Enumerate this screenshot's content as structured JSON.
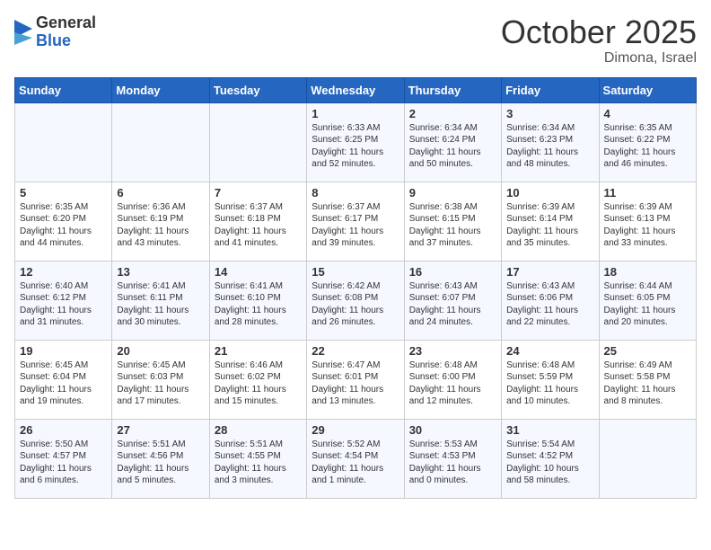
{
  "logo": {
    "general": "General",
    "blue": "Blue"
  },
  "header": {
    "month": "October 2025",
    "location": "Dimona, Israel"
  },
  "weekdays": [
    "Sunday",
    "Monday",
    "Tuesday",
    "Wednesday",
    "Thursday",
    "Friday",
    "Saturday"
  ],
  "weeks": [
    [
      {
        "day": "",
        "content": ""
      },
      {
        "day": "",
        "content": ""
      },
      {
        "day": "",
        "content": ""
      },
      {
        "day": "1",
        "content": "Sunrise: 6:33 AM\nSunset: 6:25 PM\nDaylight: 11 hours\nand 52 minutes."
      },
      {
        "day": "2",
        "content": "Sunrise: 6:34 AM\nSunset: 6:24 PM\nDaylight: 11 hours\nand 50 minutes."
      },
      {
        "day": "3",
        "content": "Sunrise: 6:34 AM\nSunset: 6:23 PM\nDaylight: 11 hours\nand 48 minutes."
      },
      {
        "day": "4",
        "content": "Sunrise: 6:35 AM\nSunset: 6:22 PM\nDaylight: 11 hours\nand 46 minutes."
      }
    ],
    [
      {
        "day": "5",
        "content": "Sunrise: 6:35 AM\nSunset: 6:20 PM\nDaylight: 11 hours\nand 44 minutes."
      },
      {
        "day": "6",
        "content": "Sunrise: 6:36 AM\nSunset: 6:19 PM\nDaylight: 11 hours\nand 43 minutes."
      },
      {
        "day": "7",
        "content": "Sunrise: 6:37 AM\nSunset: 6:18 PM\nDaylight: 11 hours\nand 41 minutes."
      },
      {
        "day": "8",
        "content": "Sunrise: 6:37 AM\nSunset: 6:17 PM\nDaylight: 11 hours\nand 39 minutes."
      },
      {
        "day": "9",
        "content": "Sunrise: 6:38 AM\nSunset: 6:15 PM\nDaylight: 11 hours\nand 37 minutes."
      },
      {
        "day": "10",
        "content": "Sunrise: 6:39 AM\nSunset: 6:14 PM\nDaylight: 11 hours\nand 35 minutes."
      },
      {
        "day": "11",
        "content": "Sunrise: 6:39 AM\nSunset: 6:13 PM\nDaylight: 11 hours\nand 33 minutes."
      }
    ],
    [
      {
        "day": "12",
        "content": "Sunrise: 6:40 AM\nSunset: 6:12 PM\nDaylight: 11 hours\nand 31 minutes."
      },
      {
        "day": "13",
        "content": "Sunrise: 6:41 AM\nSunset: 6:11 PM\nDaylight: 11 hours\nand 30 minutes."
      },
      {
        "day": "14",
        "content": "Sunrise: 6:41 AM\nSunset: 6:10 PM\nDaylight: 11 hours\nand 28 minutes."
      },
      {
        "day": "15",
        "content": "Sunrise: 6:42 AM\nSunset: 6:08 PM\nDaylight: 11 hours\nand 26 minutes."
      },
      {
        "day": "16",
        "content": "Sunrise: 6:43 AM\nSunset: 6:07 PM\nDaylight: 11 hours\nand 24 minutes."
      },
      {
        "day": "17",
        "content": "Sunrise: 6:43 AM\nSunset: 6:06 PM\nDaylight: 11 hours\nand 22 minutes."
      },
      {
        "day": "18",
        "content": "Sunrise: 6:44 AM\nSunset: 6:05 PM\nDaylight: 11 hours\nand 20 minutes."
      }
    ],
    [
      {
        "day": "19",
        "content": "Sunrise: 6:45 AM\nSunset: 6:04 PM\nDaylight: 11 hours\nand 19 minutes."
      },
      {
        "day": "20",
        "content": "Sunrise: 6:45 AM\nSunset: 6:03 PM\nDaylight: 11 hours\nand 17 minutes."
      },
      {
        "day": "21",
        "content": "Sunrise: 6:46 AM\nSunset: 6:02 PM\nDaylight: 11 hours\nand 15 minutes."
      },
      {
        "day": "22",
        "content": "Sunrise: 6:47 AM\nSunset: 6:01 PM\nDaylight: 11 hours\nand 13 minutes."
      },
      {
        "day": "23",
        "content": "Sunrise: 6:48 AM\nSunset: 6:00 PM\nDaylight: 11 hours\nand 12 minutes."
      },
      {
        "day": "24",
        "content": "Sunrise: 6:48 AM\nSunset: 5:59 PM\nDaylight: 11 hours\nand 10 minutes."
      },
      {
        "day": "25",
        "content": "Sunrise: 6:49 AM\nSunset: 5:58 PM\nDaylight: 11 hours\nand 8 minutes."
      }
    ],
    [
      {
        "day": "26",
        "content": "Sunrise: 5:50 AM\nSunset: 4:57 PM\nDaylight: 11 hours\nand 6 minutes."
      },
      {
        "day": "27",
        "content": "Sunrise: 5:51 AM\nSunset: 4:56 PM\nDaylight: 11 hours\nand 5 minutes."
      },
      {
        "day": "28",
        "content": "Sunrise: 5:51 AM\nSunset: 4:55 PM\nDaylight: 11 hours\nand 3 minutes."
      },
      {
        "day": "29",
        "content": "Sunrise: 5:52 AM\nSunset: 4:54 PM\nDaylight: 11 hours\nand 1 minute."
      },
      {
        "day": "30",
        "content": "Sunrise: 5:53 AM\nSunset: 4:53 PM\nDaylight: 11 hours\nand 0 minutes."
      },
      {
        "day": "31",
        "content": "Sunrise: 5:54 AM\nSunset: 4:52 PM\nDaylight: 10 hours\nand 58 minutes."
      },
      {
        "day": "",
        "content": ""
      }
    ]
  ]
}
